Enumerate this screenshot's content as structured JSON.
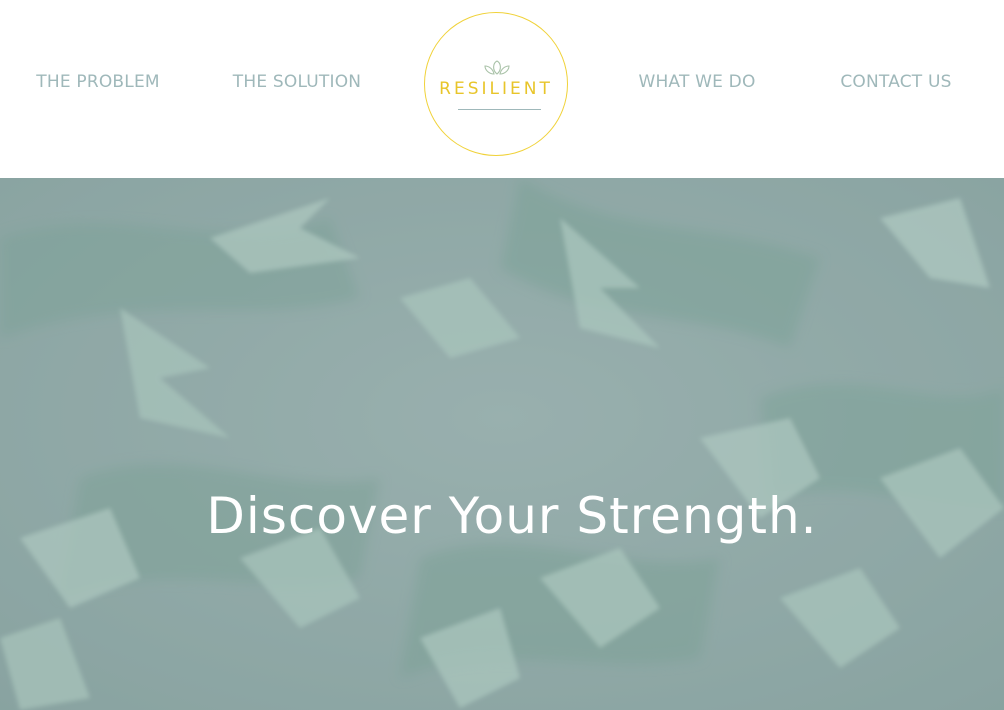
{
  "nav": {
    "left": [
      {
        "label": "THE PROBLEM"
      },
      {
        "label": "THE SOLUTION"
      }
    ],
    "right": [
      {
        "label": "WHAT WE DO"
      },
      {
        "label": "CONTACT US"
      }
    ]
  },
  "logo": {
    "text": "RESILIENT",
    "icon": "leaves-icon",
    "ring_color": "#f0d23a",
    "text_color": "#e8c52a"
  },
  "hero": {
    "heading": "Discover Your Strength.",
    "overlay_color": "#8fa7a6"
  },
  "colors": {
    "nav_text": "#9fb8ba",
    "background": "#ffffff"
  }
}
